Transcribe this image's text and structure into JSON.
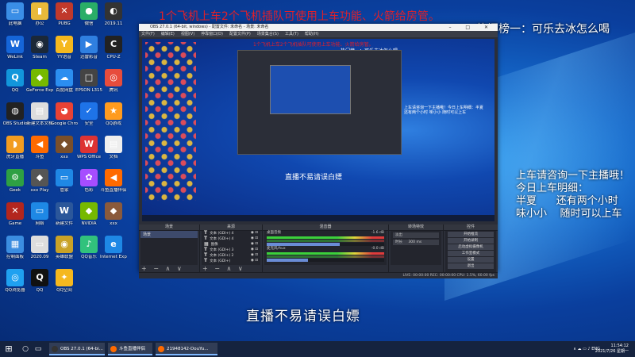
{
  "overlay": {
    "top_banner": "1个飞机上车2个飞机插队可使用上车功能、火箭给房管。",
    "hotlist": "热门榜一：可乐去冰怎么喝",
    "side_line1": "上车请咨询一下主播哦！",
    "side_line2": "今日上车明细：",
    "side_line3": "半夏      还有两个小时",
    "side_line4": "味小小    随时可以上车",
    "bottom_caption": "直播不易请误白嫖"
  },
  "desktop": {
    "icons": [
      {
        "label": "此电脑",
        "glyph": "▭",
        "color": "#3a8ee6"
      },
      {
        "label": "办公",
        "glyph": "▮",
        "color": "#e8b93a"
      },
      {
        "label": "PUBG",
        "glyph": "✕",
        "color": "#c0392b"
      },
      {
        "label": "微信",
        "glyph": "●",
        "color": "#2aae67"
      },
      {
        "label": "2019.11",
        "glyph": "◐",
        "color": "#333"
      },
      {
        "label": "WeLink",
        "glyph": "W",
        "color": "#1565d8"
      },
      {
        "label": "Steam",
        "glyph": "◉",
        "color": "#1b2838"
      },
      {
        "label": "YY语音",
        "glyph": "Y",
        "color": "#f5b81e"
      },
      {
        "label": "迅雷影音",
        "glyph": "▶",
        "color": "#2f7fe0"
      },
      {
        "label": "CPU-Z",
        "glyph": "C",
        "color": "#222"
      },
      {
        "label": "QQ",
        "glyph": "Q",
        "color": "#1296db"
      },
      {
        "label": "GeForce Experience",
        "glyph": "◆",
        "color": "#76b900"
      },
      {
        "label": "百度网盘",
        "glyph": "☁",
        "color": "#2b8ef0"
      },
      {
        "label": "EPSON L3150",
        "glyph": "□",
        "color": "#444"
      },
      {
        "label": "腾讯",
        "glyph": "◎",
        "color": "#e74c3c"
      },
      {
        "label": "OBS Studio",
        "glyph": "◍",
        "color": "#222"
      },
      {
        "label": "新建文本文档",
        "glyph": "▤",
        "color": "#ddd"
      },
      {
        "label": "Google Chrome",
        "glyph": "◕",
        "color": "#e94235"
      },
      {
        "label": "安全",
        "glyph": "✓",
        "color": "#1e73e8"
      },
      {
        "label": "QQ游戏",
        "glyph": "★",
        "color": "#ff9b1e"
      },
      {
        "label": "虎牙直播",
        "glyph": "◗",
        "color": "#f29c1f"
      },
      {
        "label": "斗鱼",
        "glyph": "◀",
        "color": "#ff6a00"
      },
      {
        "label": "xxx",
        "glyph": "◆",
        "color": "#7a4f2a"
      },
      {
        "label": "WPS Office",
        "glyph": "W",
        "color": "#d33"
      },
      {
        "label": "文档",
        "glyph": "▤",
        "color": "#eee"
      },
      {
        "label": "Geek",
        "glyph": "⚙",
        "color": "#2ea043"
      },
      {
        "label": "xxx Play",
        "glyph": "◆",
        "color": "#555"
      },
      {
        "label": "管家",
        "glyph": "▭",
        "color": "#1f88e5"
      },
      {
        "label": "色彩",
        "glyph": "✿",
        "color": "#a64dff"
      },
      {
        "label": "斗鱼直播伴侣",
        "glyph": "◀",
        "color": "#ff6a00"
      },
      {
        "label": "Game",
        "glyph": "✕",
        "color": "#b3261e"
      },
      {
        "label": "网络",
        "glyph": "▭",
        "color": "#1e88e5"
      },
      {
        "label": "新建文件",
        "glyph": "W",
        "color": "#2b579a"
      },
      {
        "label": "NVIDIA",
        "glyph": "◆",
        "color": "#76b900"
      },
      {
        "label": "xxx",
        "glyph": "◆",
        "color": "#8a5a3c"
      },
      {
        "label": "控制面板",
        "glyph": "▦",
        "color": "#3b8de0"
      },
      {
        "label": "2020.09",
        "glyph": "▭",
        "color": "#ddd"
      },
      {
        "label": "英雄联盟",
        "glyph": "◉",
        "color": "#c9a227"
      },
      {
        "label": "QQ音乐",
        "glyph": "♪",
        "color": "#31c27c"
      },
      {
        "label": "Internet Explorer",
        "glyph": "e",
        "color": "#1e88e5"
      },
      {
        "label": "QQ浏览器",
        "glyph": "◎",
        "color": "#1fa1f0"
      },
      {
        "label": "QQ",
        "glyph": "Q",
        "color": "#111"
      },
      {
        "label": "QQ空间",
        "glyph": "✦",
        "color": "#f5b81e"
      }
    ]
  },
  "obs": {
    "title": "OBS 27.0.1 (64-bit, windows) - 配置文件: 未命名 - 场景: 未命名",
    "window_buttons": "– □ ✕",
    "menu": [
      "文件(F)",
      "编辑(E)",
      "视图(V)",
      "停靠窗口(D)",
      "配置文件(P)",
      "场景集合(S)",
      "工具(T)",
      "帮助(H)"
    ],
    "preview": {
      "top_text": "1个飞机上车2个飞机插队可使用上车功能、火箭给房管。",
      "hot_text": "热门榜一：可乐去冰怎么喝",
      "side_text": "上车请咨询一下主播哦！今日上车明细：半夏 还有两个小时 味小小 随时可以上车",
      "caption": "直播不易请误白嫖"
    },
    "dock_scenes": {
      "title": "场景",
      "items": [
        "场景"
      ]
    },
    "dock_sources": {
      "title": "来源",
      "items": [
        {
          "glyph": "T",
          "label": "文本 (GDI+) 4"
        },
        {
          "glyph": "T",
          "label": "文本 (GDI+) 4"
        },
        {
          "glyph": "▦",
          "label": "图像"
        },
        {
          "glyph": "T",
          "label": "文本 (GDI+) 3"
        },
        {
          "glyph": "T",
          "label": "文本 (GDI+) 2"
        },
        {
          "glyph": "T",
          "label": "文本 (GDI+)"
        }
      ]
    },
    "dock_mixer": {
      "title": "混音器",
      "rows": [
        {
          "label": "桌面音频",
          "db": "-1.6 dB",
          "level": 0.62
        },
        {
          "label": "麦克风/Aux",
          "db": "-0.0 dB",
          "level": 0.35
        }
      ]
    },
    "dock_transitions": {
      "title": "转场特效",
      "type": "淡出",
      "duration_label": "时长",
      "duration": "300 ms"
    },
    "dock_controls": {
      "title": "控件",
      "buttons": [
        "开始推流",
        "开始录制",
        "启动虚拟摄像机",
        "工作室模式",
        "设置",
        "退出"
      ]
    },
    "status": "LIVE: 00:00:00    REC: 00:00:00    CPU: 1.5%, 60.00 fps",
    "footer_controls": "+ − ∧ ∨"
  },
  "taskbar": {
    "start_glyph": "⊞",
    "search_glyph": "○",
    "taskview_glyph": "▭",
    "apps": [
      {
        "label": "OBS 27.0.1 (64-bi...",
        "color": "#333"
      },
      {
        "label": "斗鱼直播伴侣",
        "color": "#ff6a00"
      },
      {
        "label": "21948142-DouYu...",
        "color": "#ff6a00"
      }
    ],
    "tray": "∧  ☁  ▭  ♪  ENG",
    "time": "11:54:12",
    "date": "2021/7/26 星期一"
  }
}
